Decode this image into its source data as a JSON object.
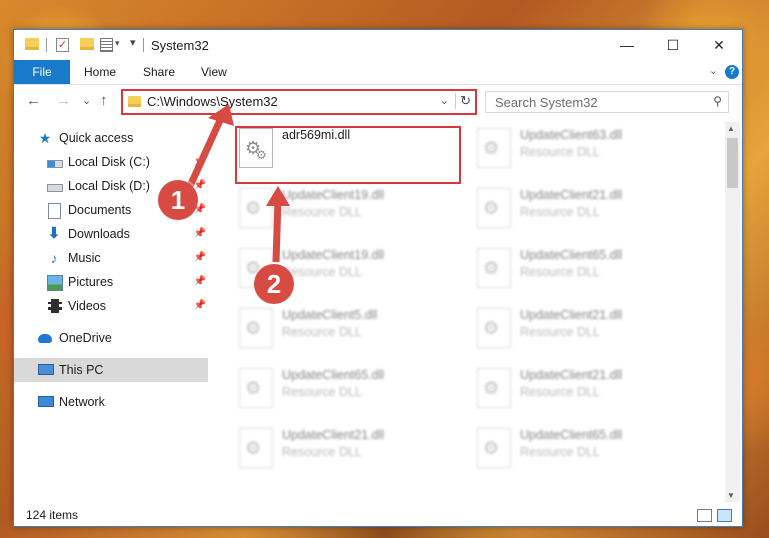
{
  "window": {
    "title": "System32",
    "controls": {
      "minimize": "—",
      "maximize": "☐",
      "close": "✕"
    }
  },
  "quick_access_toolbar": {
    "customize": "▾"
  },
  "ribbon": {
    "tabs": [
      "File",
      "Home",
      "Share",
      "View"
    ],
    "expand": "⌄",
    "help": "?"
  },
  "navigation": {
    "back": "←",
    "forward": "→",
    "recent": "⌄",
    "up": "↑",
    "address_path": "C:\\Windows\\System32",
    "address_dropdown": "⌄",
    "refresh": "↻",
    "search_placeholder": "Search System32"
  },
  "sidebar": {
    "items": [
      {
        "label": "Quick access",
        "icon": "star-icon"
      },
      {
        "label": "Local Disk (C:)",
        "icon": "drive-icon",
        "pinned": true
      },
      {
        "label": "Local Disk (D:)",
        "icon": "drive-icon",
        "pinned": true
      },
      {
        "label": "Documents",
        "icon": "document-icon",
        "pinned": true
      },
      {
        "label": "Downloads",
        "icon": "download-icon",
        "pinned": true
      },
      {
        "label": "Music",
        "icon": "music-icon",
        "pinned": true
      },
      {
        "label": "Pictures",
        "icon": "picture-icon",
        "pinned": true
      },
      {
        "label": "Videos",
        "icon": "video-icon",
        "pinned": true
      },
      {
        "label": "OneDrive",
        "icon": "cloud-icon"
      },
      {
        "label": "This PC",
        "icon": "computer-icon",
        "selected": true
      },
      {
        "label": "Network",
        "icon": "network-icon"
      }
    ],
    "pin_glyph": "📌"
  },
  "files": [
    {
      "name": "adr569mi.dll",
      "type": ""
    },
    {
      "name": "UpdateClient63.dll",
      "type": "Resource DLL"
    },
    {
      "name": "UpdateClient19.dll",
      "type": "Resource DLL"
    },
    {
      "name": "UpdateClient21.dll",
      "type": "Resource DLL"
    },
    {
      "name": "UpdateClient19.dll",
      "type": "Resource DLL"
    },
    {
      "name": "UpdateClient65.dll",
      "type": "Resource DLL"
    },
    {
      "name": "UpdateClient5.dll",
      "type": "Resource DLL"
    },
    {
      "name": "UpdateClient21.dll",
      "type": "Resource DLL"
    },
    {
      "name": "UpdateClient65.dll",
      "type": "Resource DLL"
    },
    {
      "name": "UpdateClient21.dll",
      "type": "Resource DLL"
    },
    {
      "name": "UpdateClient21.dll",
      "type": "Resource DLL"
    },
    {
      "name": "UpdateClient65.dll",
      "type": "Resource DLL"
    }
  ],
  "status": {
    "item_count": "124 items"
  },
  "annotations": {
    "marker1": "1",
    "marker2": "2",
    "color": "#d9363e"
  },
  "colors": {
    "accent": "#1979ca",
    "highlight": "#d9363e"
  }
}
